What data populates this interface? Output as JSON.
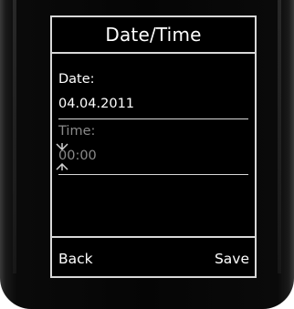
{
  "screen": {
    "title": "Date/Time",
    "date": {
      "label": "Date:",
      "value": "04.04.2011"
    },
    "time": {
      "label": "Time:",
      "value": "00:00"
    }
  },
  "softkeys": {
    "left": "Back",
    "right": "Save"
  }
}
